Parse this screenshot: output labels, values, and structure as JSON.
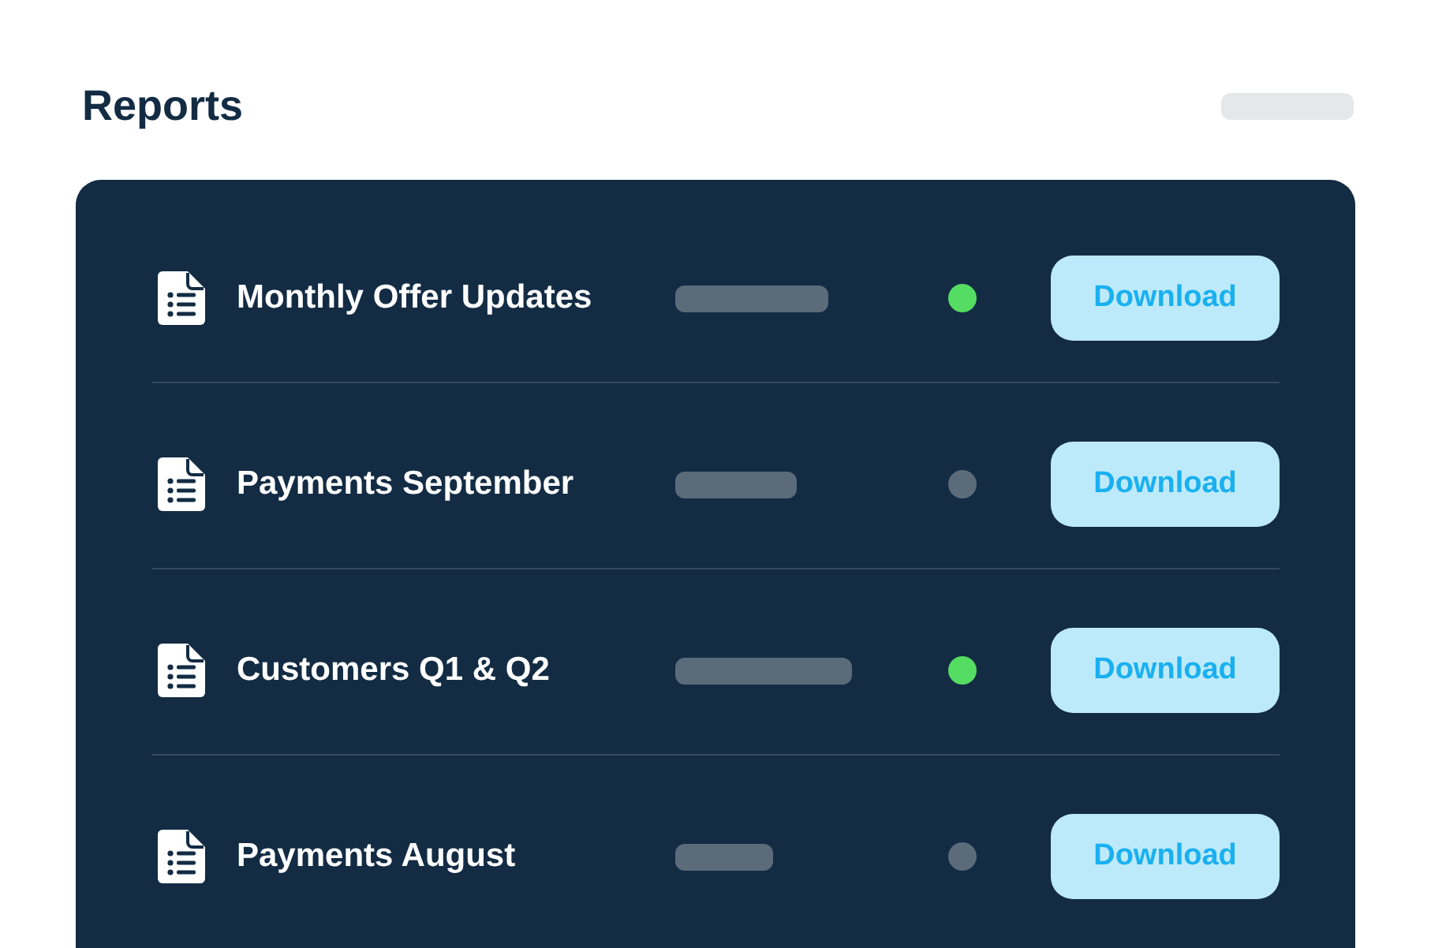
{
  "title": "Reports",
  "reports": [
    {
      "name": "Monthly Offer Updates",
      "color": "#54dc63",
      "button": "Download"
    },
    {
      "name": "Payments September",
      "color": "#5b6b7a",
      "button": "Download"
    },
    {
      "name": "Customers Q1 & Q2",
      "color": "#54dc63",
      "button": "Download"
    },
    {
      "name": "Payments August",
      "color": "#5b6b7a",
      "button": "Download"
    }
  ]
}
